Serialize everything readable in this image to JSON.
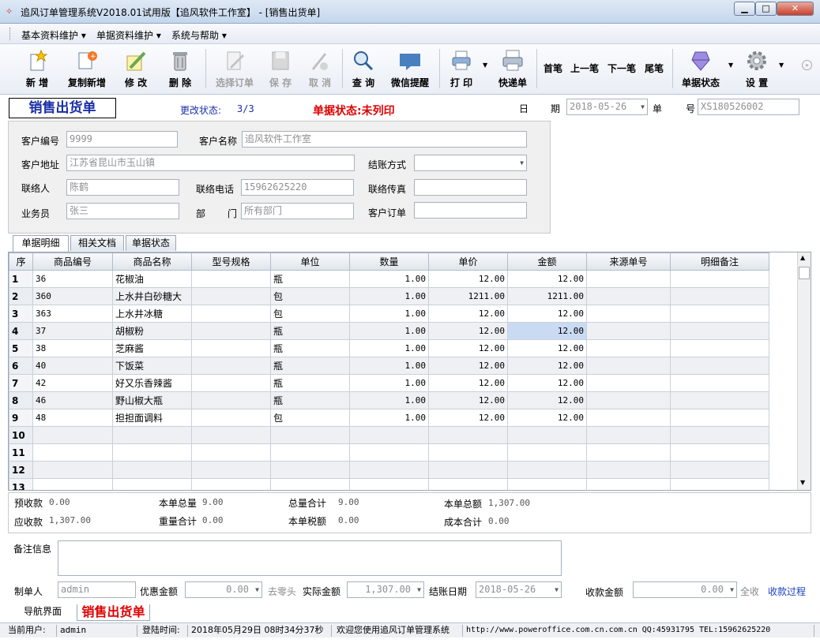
{
  "window": {
    "title": "追风订单管理系统V2018.01试用版【追风软件工作室】 - [销售出货单]",
    "minimize": "▁",
    "maximize": "□",
    "close": "✕"
  },
  "menu": [
    "基本资料维护",
    "单据资料维护",
    "系统与帮助"
  ],
  "toolbar": {
    "new": "新 增",
    "copy_new": "复制新增",
    "modify": "修 改",
    "delete": "删 除",
    "select_order": "选择订单",
    "save": "保 存",
    "cancel": "取 消",
    "query": "查 询",
    "wechat": "微信提醒",
    "print": "打 印",
    "express": "快递单",
    "first": "首笔",
    "prev": "上一笔",
    "next": "下一笔",
    "last": "尾笔",
    "doc_status": "单据状态",
    "settings": "设 置"
  },
  "header": {
    "form_title": "销售出货单",
    "change_state_label": "更改状态:",
    "change_state_value": "3/3",
    "doc_state": "单据状态:未列印",
    "date_label_1": "日",
    "date_label_2": "期",
    "date_value": "2018-05-26",
    "no_label_1": "单",
    "no_label_2": "号",
    "no_value": "XS180526002"
  },
  "customer": {
    "code_label": "客户编号",
    "code_value": "9999",
    "name_label": "客户名称",
    "name_value": "追风软件工作室",
    "address_label": "客户地址",
    "address_value": "江苏省昆山市玉山镇",
    "settle_label": "结账方式",
    "settle_value": "",
    "contact_label": "联络人",
    "contact_value": "陈鹤",
    "phone_label": "联络电话",
    "phone_value": "15962625220",
    "fax_label": "联络传真",
    "fax_value": "",
    "sales_label": "业务员",
    "sales_value": "张三",
    "dept_label_1": "部",
    "dept_label_2": "门",
    "dept_value": "所有部门",
    "order_label": "客户订单",
    "order_value": ""
  },
  "tabs": [
    "单据明细",
    "相关文档",
    "单据状态"
  ],
  "grid": {
    "columns": [
      "序",
      "商品编号",
      "商品名称",
      "型号规格",
      "单位",
      "数量",
      "单价",
      "金额",
      "来源单号",
      "明细备注"
    ],
    "rows": [
      {
        "idx": "1",
        "code": "36",
        "name": "花椒油",
        "spec": "",
        "unit": "瓶",
        "qty": "1.00",
        "price": "12.00",
        "amount": "12.00"
      },
      {
        "idx": "2",
        "code": "360",
        "name": "上水井白砂糖大",
        "spec": "",
        "unit": "包",
        "qty": "1.00",
        "price": "1211.00",
        "amount": "1211.00"
      },
      {
        "idx": "3",
        "code": "363",
        "name": "上水井冰糖",
        "spec": "",
        "unit": "包",
        "qty": "1.00",
        "price": "12.00",
        "amount": "12.00"
      },
      {
        "idx": "4",
        "code": "37",
        "name": "胡椒粉",
        "spec": "",
        "unit": "瓶",
        "qty": "1.00",
        "price": "12.00",
        "amount": "12.00"
      },
      {
        "idx": "5",
        "code": "38",
        "name": "芝麻酱",
        "spec": "",
        "unit": "瓶",
        "qty": "1.00",
        "price": "12.00",
        "amount": "12.00"
      },
      {
        "idx": "6",
        "code": "40",
        "name": "下饭菜",
        "spec": "",
        "unit": "瓶",
        "qty": "1.00",
        "price": "12.00",
        "amount": "12.00"
      },
      {
        "idx": "7",
        "code": "42",
        "name": "好又乐香辣酱",
        "spec": "",
        "unit": "瓶",
        "qty": "1.00",
        "price": "12.00",
        "amount": "12.00"
      },
      {
        "idx": "8",
        "code": "46",
        "name": "野山椒大瓶",
        "spec": "",
        "unit": "瓶",
        "qty": "1.00",
        "price": "12.00",
        "amount": "12.00"
      },
      {
        "idx": "9",
        "code": "48",
        "name": "担担面调料",
        "spec": "",
        "unit": "包",
        "qty": "1.00",
        "price": "12.00",
        "amount": "12.00"
      },
      {
        "idx": "10",
        "code": "",
        "name": "",
        "spec": "",
        "unit": "",
        "qty": "",
        "price": "",
        "amount": ""
      },
      {
        "idx": "11",
        "code": "",
        "name": "",
        "spec": "",
        "unit": "",
        "qty": "",
        "price": "",
        "amount": ""
      },
      {
        "idx": "12",
        "code": "",
        "name": "",
        "spec": "",
        "unit": "",
        "qty": "",
        "price": "",
        "amount": ""
      },
      {
        "idx": "13",
        "code": "",
        "name": "",
        "spec": "",
        "unit": "",
        "qty": "",
        "price": "",
        "amount": ""
      }
    ]
  },
  "totals": {
    "prepaid_label": "预收款",
    "prepaid_value": "0.00",
    "total_qty_label": "本单总量",
    "total_qty_value": "9.00",
    "sum_label": "总量合计",
    "sum_value": "9.00",
    "total_amount_label": "本单总额",
    "total_amount_value": "1,307.00",
    "receivable_label": "应收款",
    "receivable_value": "1,307.00",
    "weight_label": "重量合计",
    "weight_value": "0.00",
    "tax_label": "本单税额",
    "tax_value": "0.00",
    "cost_label": "成本合计",
    "cost_value": "0.00"
  },
  "footer": {
    "remark_label": "备注信息",
    "maker_label": "制单人",
    "maker_value": "admin",
    "discount_label": "优惠金额",
    "discount_value": "0.00",
    "round_label": "去零头",
    "actual_label": "实际金额",
    "actual_value": "1,307.00",
    "settle_date_label": "结账日期",
    "settle_date_value": "2018-05-26",
    "receipt_label": "收款金额",
    "receipt_value": "0.00",
    "all_receipt": "全收",
    "receipt_process": "收款过程"
  },
  "bottom_tabs": [
    "导航界面",
    "销售出货单"
  ],
  "status": {
    "user_label": "当前用户:",
    "user_value": "admin",
    "login_label": "登陆时间:",
    "login_value": "2018年05月29日 08时34分37秒",
    "welcome": "欢迎您使用追风订单管理系统",
    "site": "http://www.poweroffice.com.cn.com.cn QQ:45931795 TEL:15962625220"
  }
}
